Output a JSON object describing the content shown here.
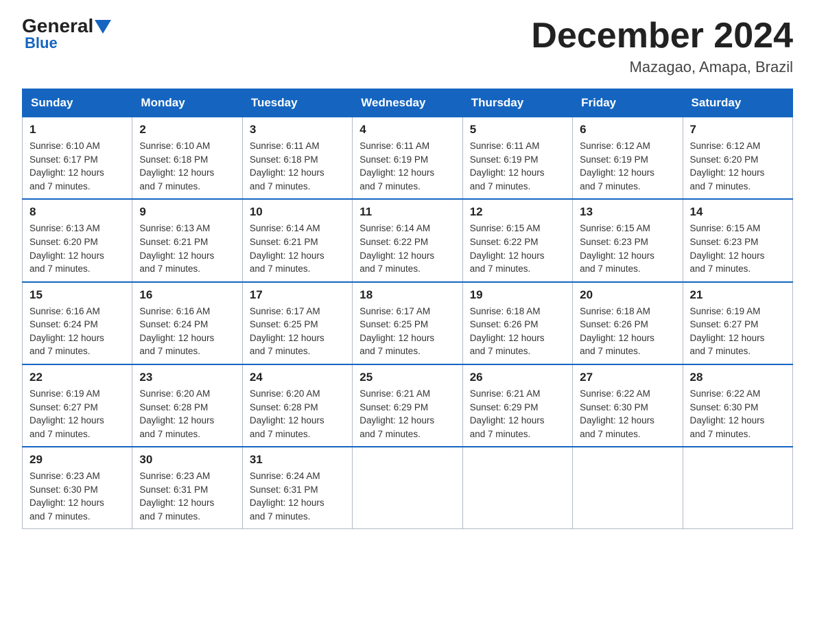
{
  "header": {
    "logo_general": "General",
    "logo_blue": "Blue",
    "title": "December 2024",
    "subtitle": "Mazagao, Amapa, Brazil"
  },
  "days_of_week": [
    "Sunday",
    "Monday",
    "Tuesday",
    "Wednesday",
    "Thursday",
    "Friday",
    "Saturday"
  ],
  "weeks": [
    [
      {
        "day": "1",
        "sunrise": "6:10 AM",
        "sunset": "6:17 PM",
        "daylight": "12 hours and 7 minutes."
      },
      {
        "day": "2",
        "sunrise": "6:10 AM",
        "sunset": "6:18 PM",
        "daylight": "12 hours and 7 minutes."
      },
      {
        "day": "3",
        "sunrise": "6:11 AM",
        "sunset": "6:18 PM",
        "daylight": "12 hours and 7 minutes."
      },
      {
        "day": "4",
        "sunrise": "6:11 AM",
        "sunset": "6:19 PM",
        "daylight": "12 hours and 7 minutes."
      },
      {
        "day": "5",
        "sunrise": "6:11 AM",
        "sunset": "6:19 PM",
        "daylight": "12 hours and 7 minutes."
      },
      {
        "day": "6",
        "sunrise": "6:12 AM",
        "sunset": "6:19 PM",
        "daylight": "12 hours and 7 minutes."
      },
      {
        "day": "7",
        "sunrise": "6:12 AM",
        "sunset": "6:20 PM",
        "daylight": "12 hours and 7 minutes."
      }
    ],
    [
      {
        "day": "8",
        "sunrise": "6:13 AM",
        "sunset": "6:20 PM",
        "daylight": "12 hours and 7 minutes."
      },
      {
        "day": "9",
        "sunrise": "6:13 AM",
        "sunset": "6:21 PM",
        "daylight": "12 hours and 7 minutes."
      },
      {
        "day": "10",
        "sunrise": "6:14 AM",
        "sunset": "6:21 PM",
        "daylight": "12 hours and 7 minutes."
      },
      {
        "day": "11",
        "sunrise": "6:14 AM",
        "sunset": "6:22 PM",
        "daylight": "12 hours and 7 minutes."
      },
      {
        "day": "12",
        "sunrise": "6:15 AM",
        "sunset": "6:22 PM",
        "daylight": "12 hours and 7 minutes."
      },
      {
        "day": "13",
        "sunrise": "6:15 AM",
        "sunset": "6:23 PM",
        "daylight": "12 hours and 7 minutes."
      },
      {
        "day": "14",
        "sunrise": "6:15 AM",
        "sunset": "6:23 PM",
        "daylight": "12 hours and 7 minutes."
      }
    ],
    [
      {
        "day": "15",
        "sunrise": "6:16 AM",
        "sunset": "6:24 PM",
        "daylight": "12 hours and 7 minutes."
      },
      {
        "day": "16",
        "sunrise": "6:16 AM",
        "sunset": "6:24 PM",
        "daylight": "12 hours and 7 minutes."
      },
      {
        "day": "17",
        "sunrise": "6:17 AM",
        "sunset": "6:25 PM",
        "daylight": "12 hours and 7 minutes."
      },
      {
        "day": "18",
        "sunrise": "6:17 AM",
        "sunset": "6:25 PM",
        "daylight": "12 hours and 7 minutes."
      },
      {
        "day": "19",
        "sunrise": "6:18 AM",
        "sunset": "6:26 PM",
        "daylight": "12 hours and 7 minutes."
      },
      {
        "day": "20",
        "sunrise": "6:18 AM",
        "sunset": "6:26 PM",
        "daylight": "12 hours and 7 minutes."
      },
      {
        "day": "21",
        "sunrise": "6:19 AM",
        "sunset": "6:27 PM",
        "daylight": "12 hours and 7 minutes."
      }
    ],
    [
      {
        "day": "22",
        "sunrise": "6:19 AM",
        "sunset": "6:27 PM",
        "daylight": "12 hours and 7 minutes."
      },
      {
        "day": "23",
        "sunrise": "6:20 AM",
        "sunset": "6:28 PM",
        "daylight": "12 hours and 7 minutes."
      },
      {
        "day": "24",
        "sunrise": "6:20 AM",
        "sunset": "6:28 PM",
        "daylight": "12 hours and 7 minutes."
      },
      {
        "day": "25",
        "sunrise": "6:21 AM",
        "sunset": "6:29 PM",
        "daylight": "12 hours and 7 minutes."
      },
      {
        "day": "26",
        "sunrise": "6:21 AM",
        "sunset": "6:29 PM",
        "daylight": "12 hours and 7 minutes."
      },
      {
        "day": "27",
        "sunrise": "6:22 AM",
        "sunset": "6:30 PM",
        "daylight": "12 hours and 7 minutes."
      },
      {
        "day": "28",
        "sunrise": "6:22 AM",
        "sunset": "6:30 PM",
        "daylight": "12 hours and 7 minutes."
      }
    ],
    [
      {
        "day": "29",
        "sunrise": "6:23 AM",
        "sunset": "6:30 PM",
        "daylight": "12 hours and 7 minutes."
      },
      {
        "day": "30",
        "sunrise": "6:23 AM",
        "sunset": "6:31 PM",
        "daylight": "12 hours and 7 minutes."
      },
      {
        "day": "31",
        "sunrise": "6:24 AM",
        "sunset": "6:31 PM",
        "daylight": "12 hours and 7 minutes."
      },
      null,
      null,
      null,
      null
    ]
  ]
}
